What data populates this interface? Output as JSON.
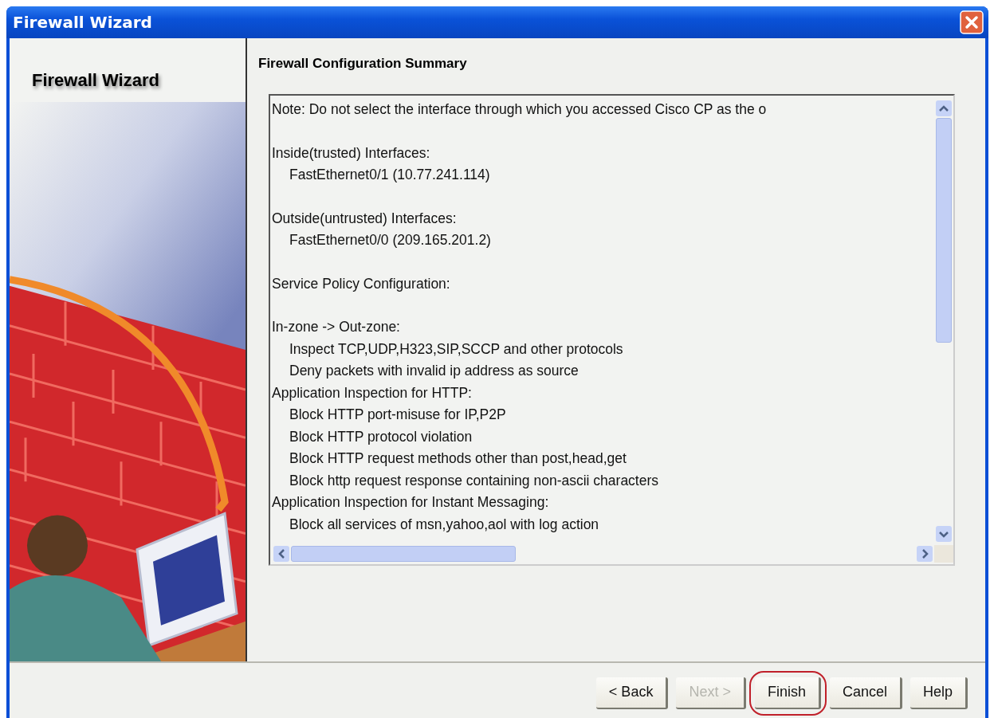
{
  "window": {
    "title": "Firewall Wizard"
  },
  "sidebar": {
    "title": "Firewall Wizard"
  },
  "page_title": "Firewall Configuration Summary",
  "summary": {
    "sections": [
      {
        "lines": [
          {
            "kind": "heading",
            "text": "Note: Do not select the interface through which you accessed Cisco CP as the o"
          }
        ]
      },
      {
        "lines": [
          {
            "kind": "heading",
            "text": "Inside(trusted) Interfaces:"
          },
          {
            "kind": "item",
            "text": "FastEthernet0/1 (10.77.241.114)"
          }
        ]
      },
      {
        "lines": [
          {
            "kind": "heading",
            "text": "Outside(untrusted) Interfaces:"
          },
          {
            "kind": "item",
            "text": "FastEthernet0/0 (209.165.201.2)"
          }
        ]
      },
      {
        "lines": [
          {
            "kind": "heading",
            "text": "Service Policy Configuration:"
          }
        ]
      },
      {
        "lines": [
          {
            "kind": "heading",
            "text": "In-zone -> Out-zone:"
          },
          {
            "kind": "item",
            "text": "Inspect TCP,UDP,H323,SIP,SCCP and other protocols"
          },
          {
            "kind": "item",
            "text": "Deny packets with invalid ip address as source"
          },
          {
            "kind": "heading",
            "text": "Application Inspection for HTTP:"
          },
          {
            "kind": "item",
            "text": "Block HTTP port-misuse for IP,P2P"
          },
          {
            "kind": "item",
            "text": "Block HTTP protocol violation"
          },
          {
            "kind": "item",
            "text": "Block HTTP request methods other than post,head,get"
          },
          {
            "kind": "item",
            "text": "Block http request response containing non-ascii characters"
          },
          {
            "kind": "heading",
            "text": "Application Inspection for Instant Messaging:"
          },
          {
            "kind": "item",
            "text": "Block all services of msn,yahoo,aol with log action"
          }
        ]
      }
    ]
  },
  "buttons": [
    {
      "label": "< Back",
      "disabled": false,
      "highlighted": false
    },
    {
      "label": "Next >",
      "disabled": true,
      "highlighted": false
    },
    {
      "label": "Finish",
      "disabled": false,
      "highlighted": true
    },
    {
      "label": "Cancel",
      "disabled": false,
      "highlighted": false
    },
    {
      "label": "Help",
      "disabled": false,
      "highlighted": false
    }
  ]
}
